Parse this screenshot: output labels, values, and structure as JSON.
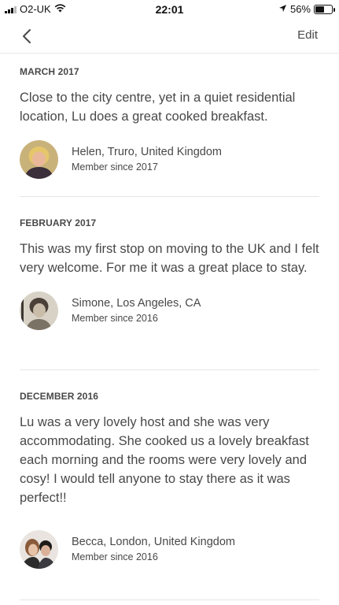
{
  "status_bar": {
    "carrier": "O2-UK",
    "time": "22:01",
    "battery": "56%",
    "battery_level": 0.56,
    "icons": [
      "signal-icon",
      "wifi-icon",
      "location-arrow-icon",
      "battery-icon"
    ]
  },
  "nav": {
    "back_icon": "chevron-left-icon",
    "edit_label": "Edit"
  },
  "reviews": [
    {
      "date": "MARCH 2017",
      "text": "Close to the city centre, yet in a quiet residential location, Lu does a great cooked breakfast.",
      "reviewer": "Helen, Truro, United Kingdom",
      "member_since": "Member since 2017"
    },
    {
      "date": "FEBRUARY 2017",
      "text": "This was my first stop on moving to the UK and I felt very welcome. For me it was a great place to stay.",
      "reviewer": "Simone, Los Angeles, CA",
      "member_since": "Member since 2016"
    },
    {
      "date": "DECEMBER 2016",
      "text": "Lu was a very lovely host and she was very accommodating. She cooked us a lovely breakfast each morning and the rooms were very lovely and cosy! I would tell anyone to stay there as it was perfect!!",
      "reviewer": "Becca, London, United Kingdom",
      "member_since": "Member since 2016"
    }
  ]
}
